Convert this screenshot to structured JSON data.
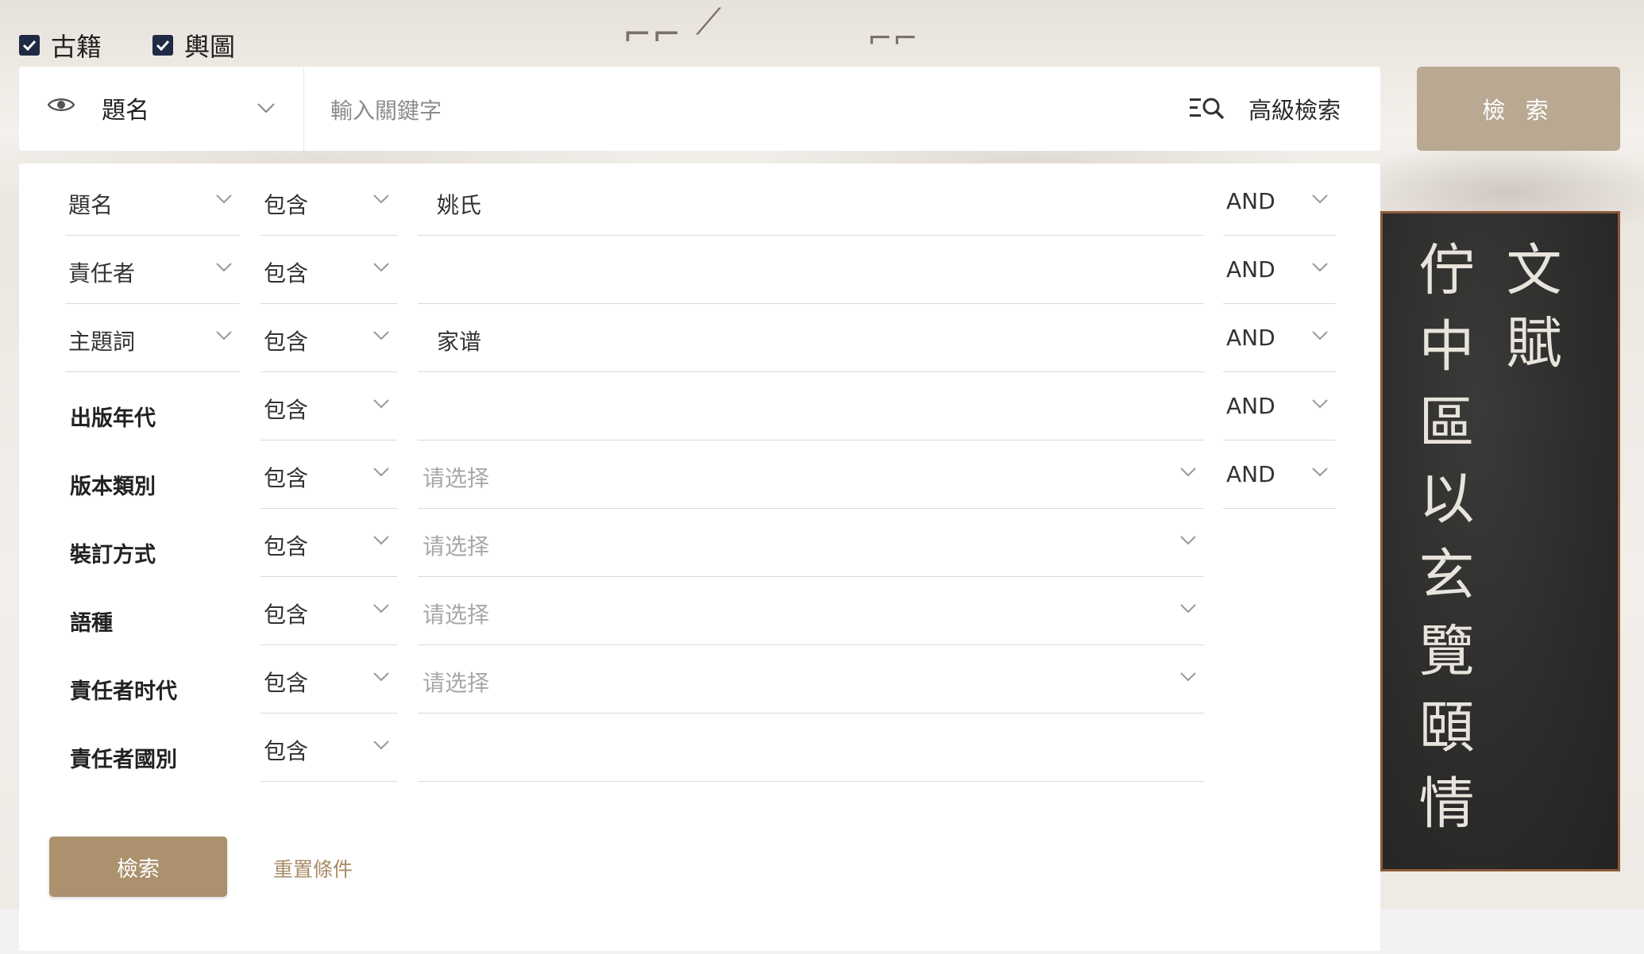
{
  "filters": {
    "ancient_books_label": "古籍",
    "maps_label": "輿圖"
  },
  "searchbar": {
    "field_label": "題名",
    "keyword_placeholder": "輸入關鍵字",
    "advanced_label": "高級檢索",
    "search_button": "檢 索"
  },
  "advanced": {
    "rows": [
      {
        "field": "題名",
        "op": "包含",
        "value": "姚氏",
        "logic": "AND"
      },
      {
        "field": "責任者",
        "op": "包含",
        "value": "",
        "logic": "AND"
      },
      {
        "field": "主題詞",
        "op": "包含",
        "value": "家谱",
        "logic": "AND"
      },
      {
        "field": "出版年代",
        "op": "包含",
        "value": "",
        "logic": "AND"
      },
      {
        "field": "版本類別",
        "op": "包含",
        "placeholder": "请选择",
        "logic": "AND"
      },
      {
        "field": "裝訂方式",
        "op": "包含",
        "placeholder": "请选择"
      },
      {
        "field": "語種",
        "op": "包含",
        "placeholder": "请选择"
      },
      {
        "field": "責任者时代",
        "op": "包含",
        "placeholder": "请选择"
      },
      {
        "field": "責任者國別",
        "op": "包含",
        "value": ""
      }
    ],
    "submit_label": "檢索",
    "reset_label": "重置條件"
  },
  "calligraphy": {
    "right_column": "文賦",
    "left_column": "佇中區以玄覽頤情"
  },
  "colors": {
    "accent": "#ab916d",
    "top_button": "#b9a892",
    "checkbox": "#1f2a44"
  }
}
